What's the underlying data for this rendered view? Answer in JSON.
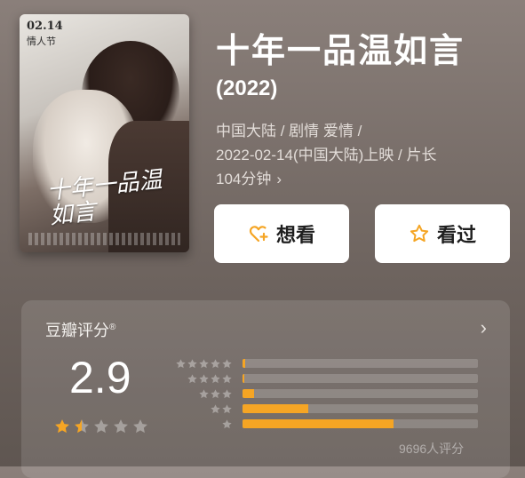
{
  "poster": {
    "date_text": "02.14",
    "tag_text": "情人节",
    "title_art": "十年一品温如言"
  },
  "movie": {
    "title": "十年一品温如言",
    "year": "(2022)",
    "meta_line1": "中国大陆 / 剧情 爱情 /",
    "meta_line2": "2022-02-14(中国大陆)上映 / 片长",
    "meta_line3": "104分钟",
    "meta_chevron": "›"
  },
  "actions": {
    "want_label": "想看",
    "seen_label": "看过",
    "accent": "#f5a524"
  },
  "rating": {
    "label": "豆瓣评分",
    "label_mark": "®",
    "score": "2.9",
    "stars_value": 1.5,
    "stars_max": 5,
    "count_text": "9696人评分",
    "chevron": "›",
    "distribution": [
      {
        "stars": 5,
        "fraction": 0.01
      },
      {
        "stars": 4,
        "fraction": 0.0
      },
      {
        "stars": 3,
        "fraction": 0.05
      },
      {
        "stars": 2,
        "fraction": 0.28
      },
      {
        "stars": 1,
        "fraction": 0.64
      }
    ]
  },
  "colors": {
    "star_filled": "#f5a524",
    "star_empty": "rgba(255,255,255,0.35)"
  }
}
